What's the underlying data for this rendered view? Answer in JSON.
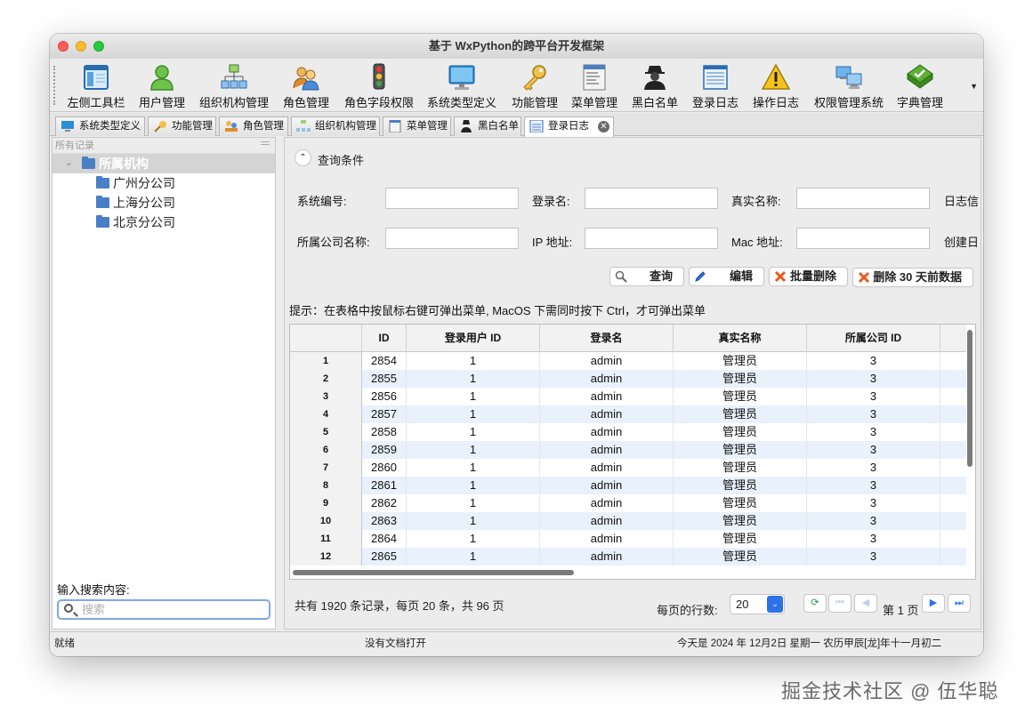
{
  "window": {
    "title": "基于 WxPython的跨平台开发框架"
  },
  "toolbar": {
    "items": [
      {
        "label": "左侧工具栏",
        "icon": "sidebar-panel-icon"
      },
      {
        "label": "用户管理",
        "icon": "user-icon"
      },
      {
        "label": "组织机构管理",
        "icon": "org-chart-icon"
      },
      {
        "label": "角色管理",
        "icon": "role-people-icon"
      },
      {
        "label": "角色字段权限",
        "icon": "traffic-light-icon"
      },
      {
        "label": "系统类型定义",
        "icon": "monitor-icon"
      },
      {
        "label": "功能管理",
        "icon": "key-icon"
      },
      {
        "label": "菜单管理",
        "icon": "menu-window-icon"
      },
      {
        "label": "黑白名单",
        "icon": "spy-icon"
      },
      {
        "label": "登录日志",
        "icon": "log-document-icon"
      },
      {
        "label": "操作日志",
        "icon": "warning-icon"
      },
      {
        "label": "权限管理系统",
        "icon": "network-computers-icon"
      },
      {
        "label": "字典管理",
        "icon": "dictionary-book-icon"
      }
    ],
    "more_glyph": "▼"
  },
  "tabs": [
    {
      "label": "系统类型定义",
      "icon": "monitor-icon"
    },
    {
      "label": "功能管理",
      "icon": "key-icon"
    },
    {
      "label": "角色管理",
      "icon": "role-people-icon"
    },
    {
      "label": "组织机构管理",
      "icon": "org-chart-icon"
    },
    {
      "label": "菜单管理",
      "icon": "menu-window-icon"
    },
    {
      "label": "黑白名单",
      "icon": "spy-icon"
    },
    {
      "label": "登录日志",
      "icon": "log-document-icon",
      "active": true
    }
  ],
  "tab_close_glyph": "✕",
  "left_panel": {
    "header": "所有记录",
    "tree": {
      "root": "所属机构",
      "children": [
        "广州分公司",
        "上海分公司",
        "北京分公司"
      ]
    },
    "search_label": "输入搜索内容:",
    "search_placeholder": "搜索"
  },
  "query": {
    "section_title": "查询条件",
    "collapse_glyph": "⌃",
    "fields": {
      "system_id": "系统编号:",
      "login_name": "登录名:",
      "real_name": "真实名称:",
      "log_info": "日志信",
      "company_name": "所属公司名称:",
      "ip": "IP 地址:",
      "mac": "Mac 地址:",
      "created": "创建日"
    },
    "buttons": {
      "search": "查询",
      "edit": "编辑",
      "batch_delete": "批量删除",
      "delete_30": "删除 30 天前数据"
    }
  },
  "hint": "提示：在表格中按鼠标右键可弹出菜单, MacOS 下需同时按下 Ctrl，才可弹出菜单",
  "table": {
    "columns": [
      "ID",
      "登录用户 ID",
      "登录名",
      "真实名称",
      "所属公司 ID"
    ],
    "rows": [
      {
        "n": "1",
        "id": "2854",
        "user_id": "1",
        "login": "admin",
        "real": "管理员",
        "company": "3"
      },
      {
        "n": "2",
        "id": "2855",
        "user_id": "1",
        "login": "admin",
        "real": "管理员",
        "company": "3"
      },
      {
        "n": "3",
        "id": "2856",
        "user_id": "1",
        "login": "admin",
        "real": "管理员",
        "company": "3"
      },
      {
        "n": "4",
        "id": "2857",
        "user_id": "1",
        "login": "admin",
        "real": "管理员",
        "company": "3"
      },
      {
        "n": "5",
        "id": "2858",
        "user_id": "1",
        "login": "admin",
        "real": "管理员",
        "company": "3"
      },
      {
        "n": "6",
        "id": "2859",
        "user_id": "1",
        "login": "admin",
        "real": "管理员",
        "company": "3"
      },
      {
        "n": "7",
        "id": "2860",
        "user_id": "1",
        "login": "admin",
        "real": "管理员",
        "company": "3"
      },
      {
        "n": "8",
        "id": "2861",
        "user_id": "1",
        "login": "admin",
        "real": "管理员",
        "company": "3"
      },
      {
        "n": "9",
        "id": "2862",
        "user_id": "1",
        "login": "admin",
        "real": "管理员",
        "company": "3"
      },
      {
        "n": "10",
        "id": "2863",
        "user_id": "1",
        "login": "admin",
        "real": "管理员",
        "company": "3"
      },
      {
        "n": "11",
        "id": "2864",
        "user_id": "1",
        "login": "admin",
        "real": "管理员",
        "company": "3"
      },
      {
        "n": "12",
        "id": "2865",
        "user_id": "1",
        "login": "admin",
        "real": "管理员",
        "company": "3"
      }
    ]
  },
  "pager": {
    "summary": "共有 1920 条记录，每页 20 条，共 96 页",
    "rows_label": "每页的行数:",
    "rows_value": "20",
    "page_label": "第 1 页",
    "refresh_glyph": "⟳",
    "first_glyph": "⏮",
    "prev_glyph": "◀",
    "next_glyph": "▶",
    "last_glyph": "⏭",
    "select_glyph": "⌄"
  },
  "status": {
    "left": "就绪",
    "middle": "没有文档打开",
    "right": "今天是 2024 年 12月2日 星期一 农历甲辰[龙]年十一月初二"
  },
  "watermark": "掘金技术社区 @ 伍华聪",
  "colors": {
    "accent": "#2c73e8",
    "row_alt": "#e8f1fc",
    "search_focus": "#7ea7e8"
  }
}
